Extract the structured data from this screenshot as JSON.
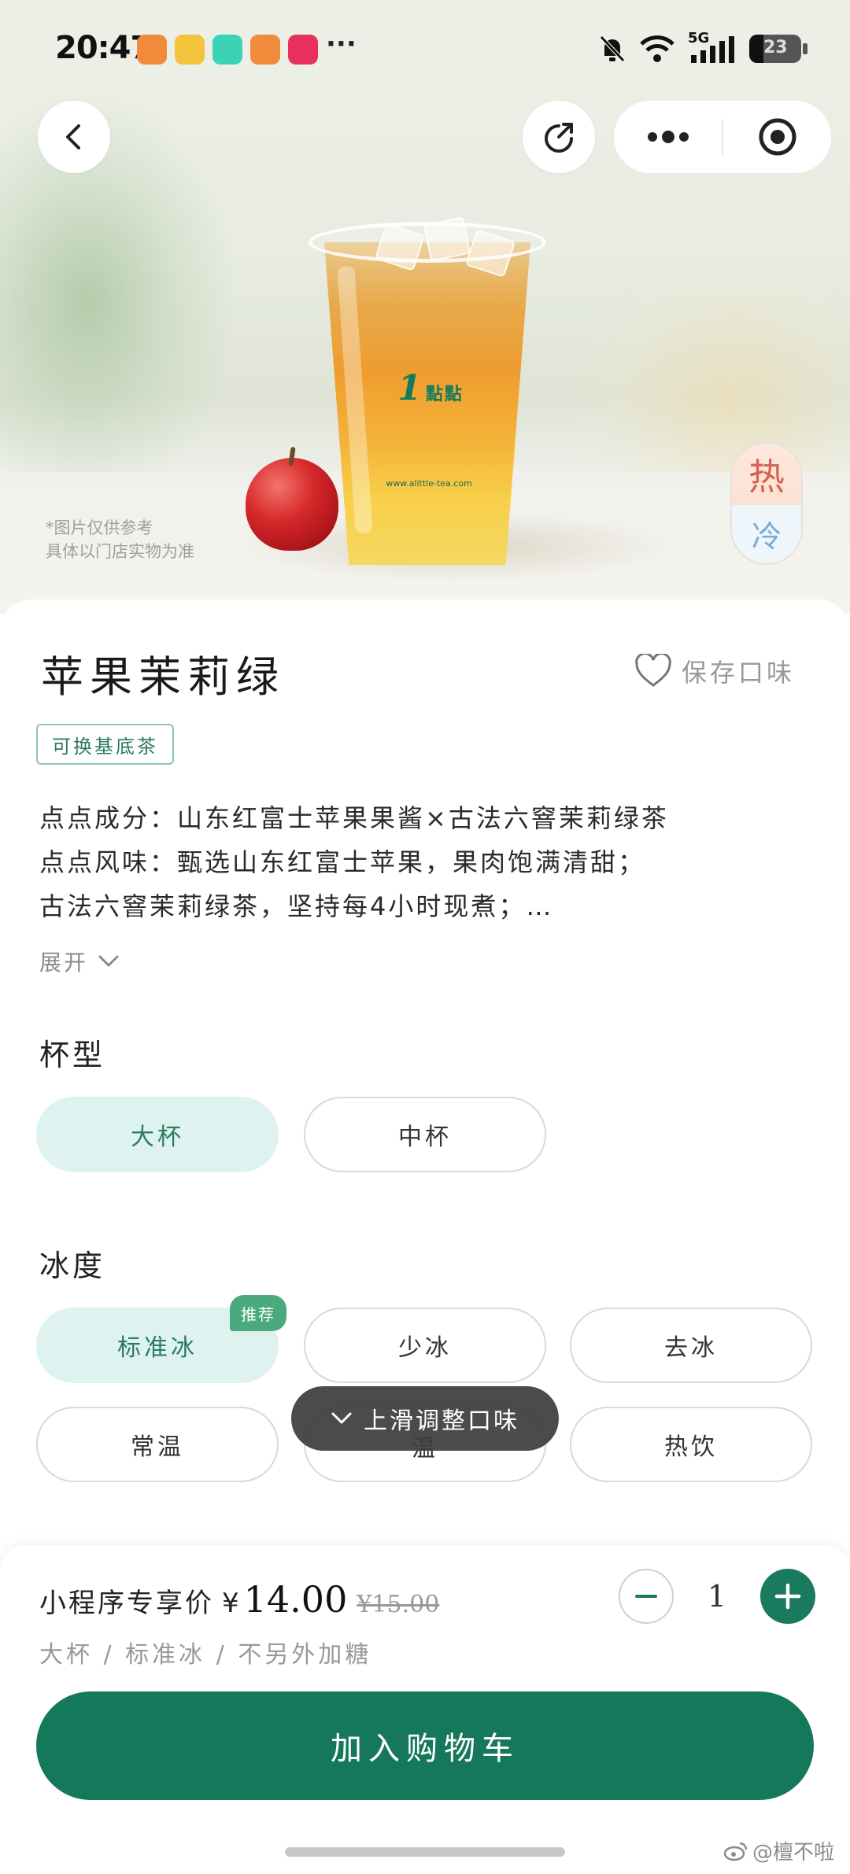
{
  "status_bar": {
    "time": "20:47",
    "more": "···",
    "network": "5G",
    "battery": "23"
  },
  "hero": {
    "disclaimer_line1": "*图片仅供参考",
    "disclaimer_line2": "具体以门店实物为准",
    "cup_logo_number": "1",
    "cup_logo_text": "點點",
    "cup_url": "www.alittle-tea.com",
    "temp_hot": "热",
    "temp_cold": "冷"
  },
  "product": {
    "title": "苹果茉莉绿",
    "save_taste": "保存口味",
    "base_tag": "可换基底茶",
    "desc_line1": "点点成分：山东红富士苹果果酱×古法六窨茉莉绿茶",
    "desc_line2": "点点风味：甄选山东红富士苹果，果肉饱满清甜；",
    "desc_line3": "古法六窨茉莉绿茶，坚持每4小时现煮；…",
    "expand": "展开"
  },
  "cup_size": {
    "title": "杯型",
    "options": [
      "大杯",
      "中杯"
    ],
    "selected": "大杯"
  },
  "ice": {
    "title": "冰度",
    "options": [
      "标准冰",
      "少冰",
      "去冰",
      "常温",
      "温",
      "热饮"
    ],
    "selected": "标准冰",
    "recommend_badge": "推荐"
  },
  "toast": {
    "text": "上滑调整口味"
  },
  "bottom_bar": {
    "price_label": "小程序专享价",
    "currency": "¥",
    "price": "14.00",
    "original_price": "¥15.00",
    "quantity": "1",
    "summary": "大杯 / 标准冰 / 不另外加糖",
    "add_to_cart": "加入购物车"
  },
  "watermark": "@檀不啦",
  "colors": {
    "brand_green": "#16785a",
    "selected_bg": "#def3ef",
    "hot_red": "#d8604f",
    "cold_blue": "#7aa8d8"
  }
}
